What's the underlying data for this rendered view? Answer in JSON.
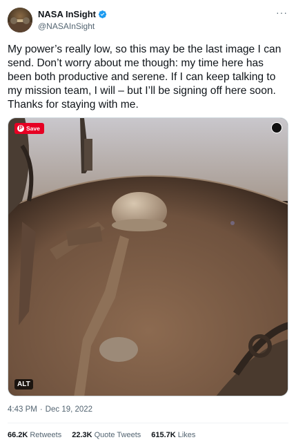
{
  "author": {
    "display_name": "NASA InSight",
    "handle": "@NASAInSight",
    "verified": true
  },
  "tweet": {
    "text": "My power’s really low, so this may be the last image I can send. Don’t worry about me though: my time here has been both productive and serene. If I can keep talking to my mission team, I will – but I’ll be signing off here soon. Thanks for staying with me.",
    "time": "4:43 PM",
    "separator": "·",
    "date": "Dec 19, 2022"
  },
  "media": {
    "save_label": "Save",
    "alt_label": "ALT"
  },
  "stats": [
    {
      "count": "66.2K",
      "label": "Retweets"
    },
    {
      "count": "22.3K",
      "label": "Quote Tweets"
    },
    {
      "count": "615.7K",
      "label": "Likes"
    }
  ],
  "colors": {
    "verified": "#1d9bf0",
    "pinterest": "#e60023",
    "text": "#0f1419",
    "secondary": "#536471"
  },
  "icons": {
    "verified": "verified-badge-icon",
    "more": "more-icon",
    "lens": "visual-search-icon",
    "pinterest": "pinterest-icon"
  }
}
